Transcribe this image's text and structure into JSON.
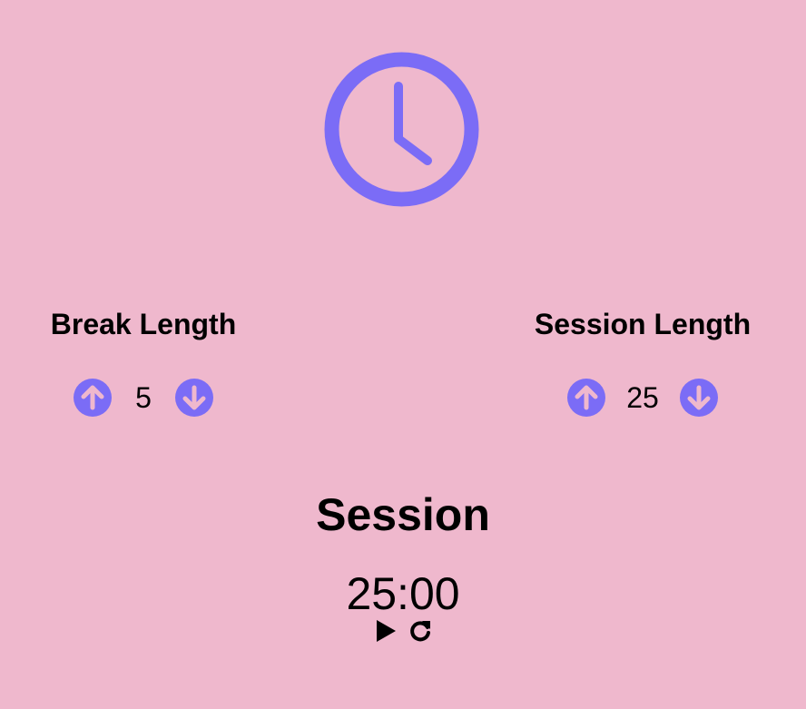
{
  "logo": {
    "icon": "clock-icon",
    "color": "#7b6cf6"
  },
  "break": {
    "title": "Break Length",
    "value": "5",
    "increment_icon": "arrow-circle-up-icon",
    "decrement_icon": "arrow-circle-down-icon"
  },
  "session": {
    "title": "Session Length",
    "value": "25",
    "increment_icon": "arrow-circle-up-icon",
    "decrement_icon": "arrow-circle-down-icon"
  },
  "timer": {
    "label": "Session",
    "time": "25:00",
    "play_icon": "play-icon",
    "reset_icon": "reset-icon"
  },
  "colors": {
    "background": "#efb8cd",
    "accent": "#7b6cf6",
    "arrow": "#efb8cd",
    "text": "#000000"
  }
}
